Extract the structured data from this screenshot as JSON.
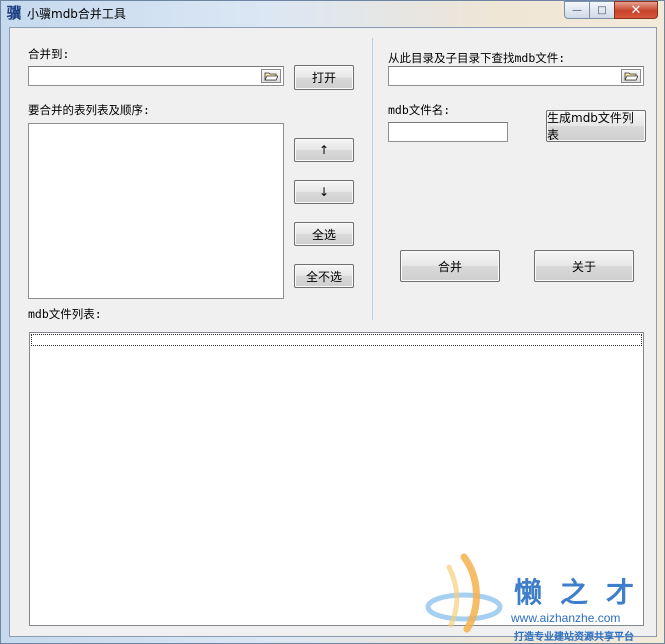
{
  "window": {
    "title": "小骥mdb合并工具",
    "icon_glyph": "骥",
    "controls": {
      "minimize": "—",
      "maximize": "□",
      "close": "✕"
    }
  },
  "left": {
    "merge_to_label": "合并到:",
    "merge_to_value": "",
    "open_button": "打开",
    "tables_label": "要合并的表列表及顺序:",
    "tables_items": [],
    "up_button": "↑",
    "down_button": "↓",
    "select_all_button": "全选",
    "select_none_button": "全不选"
  },
  "right": {
    "search_dir_label": "从此目录及子目录下查找mdb文件:",
    "search_dir_value": "",
    "filename_label": "mdb文件名:",
    "filename_value": "",
    "generate_button": "生成mdb文件列表",
    "merge_button": "合并",
    "about_button": "关于"
  },
  "file_list": {
    "label": "mdb文件列表:",
    "items": []
  },
  "watermark": {
    "brand": "懒之才",
    "url": "www.aizhanzhe.com",
    "slogan": "打造专业建站资源共享平台"
  }
}
